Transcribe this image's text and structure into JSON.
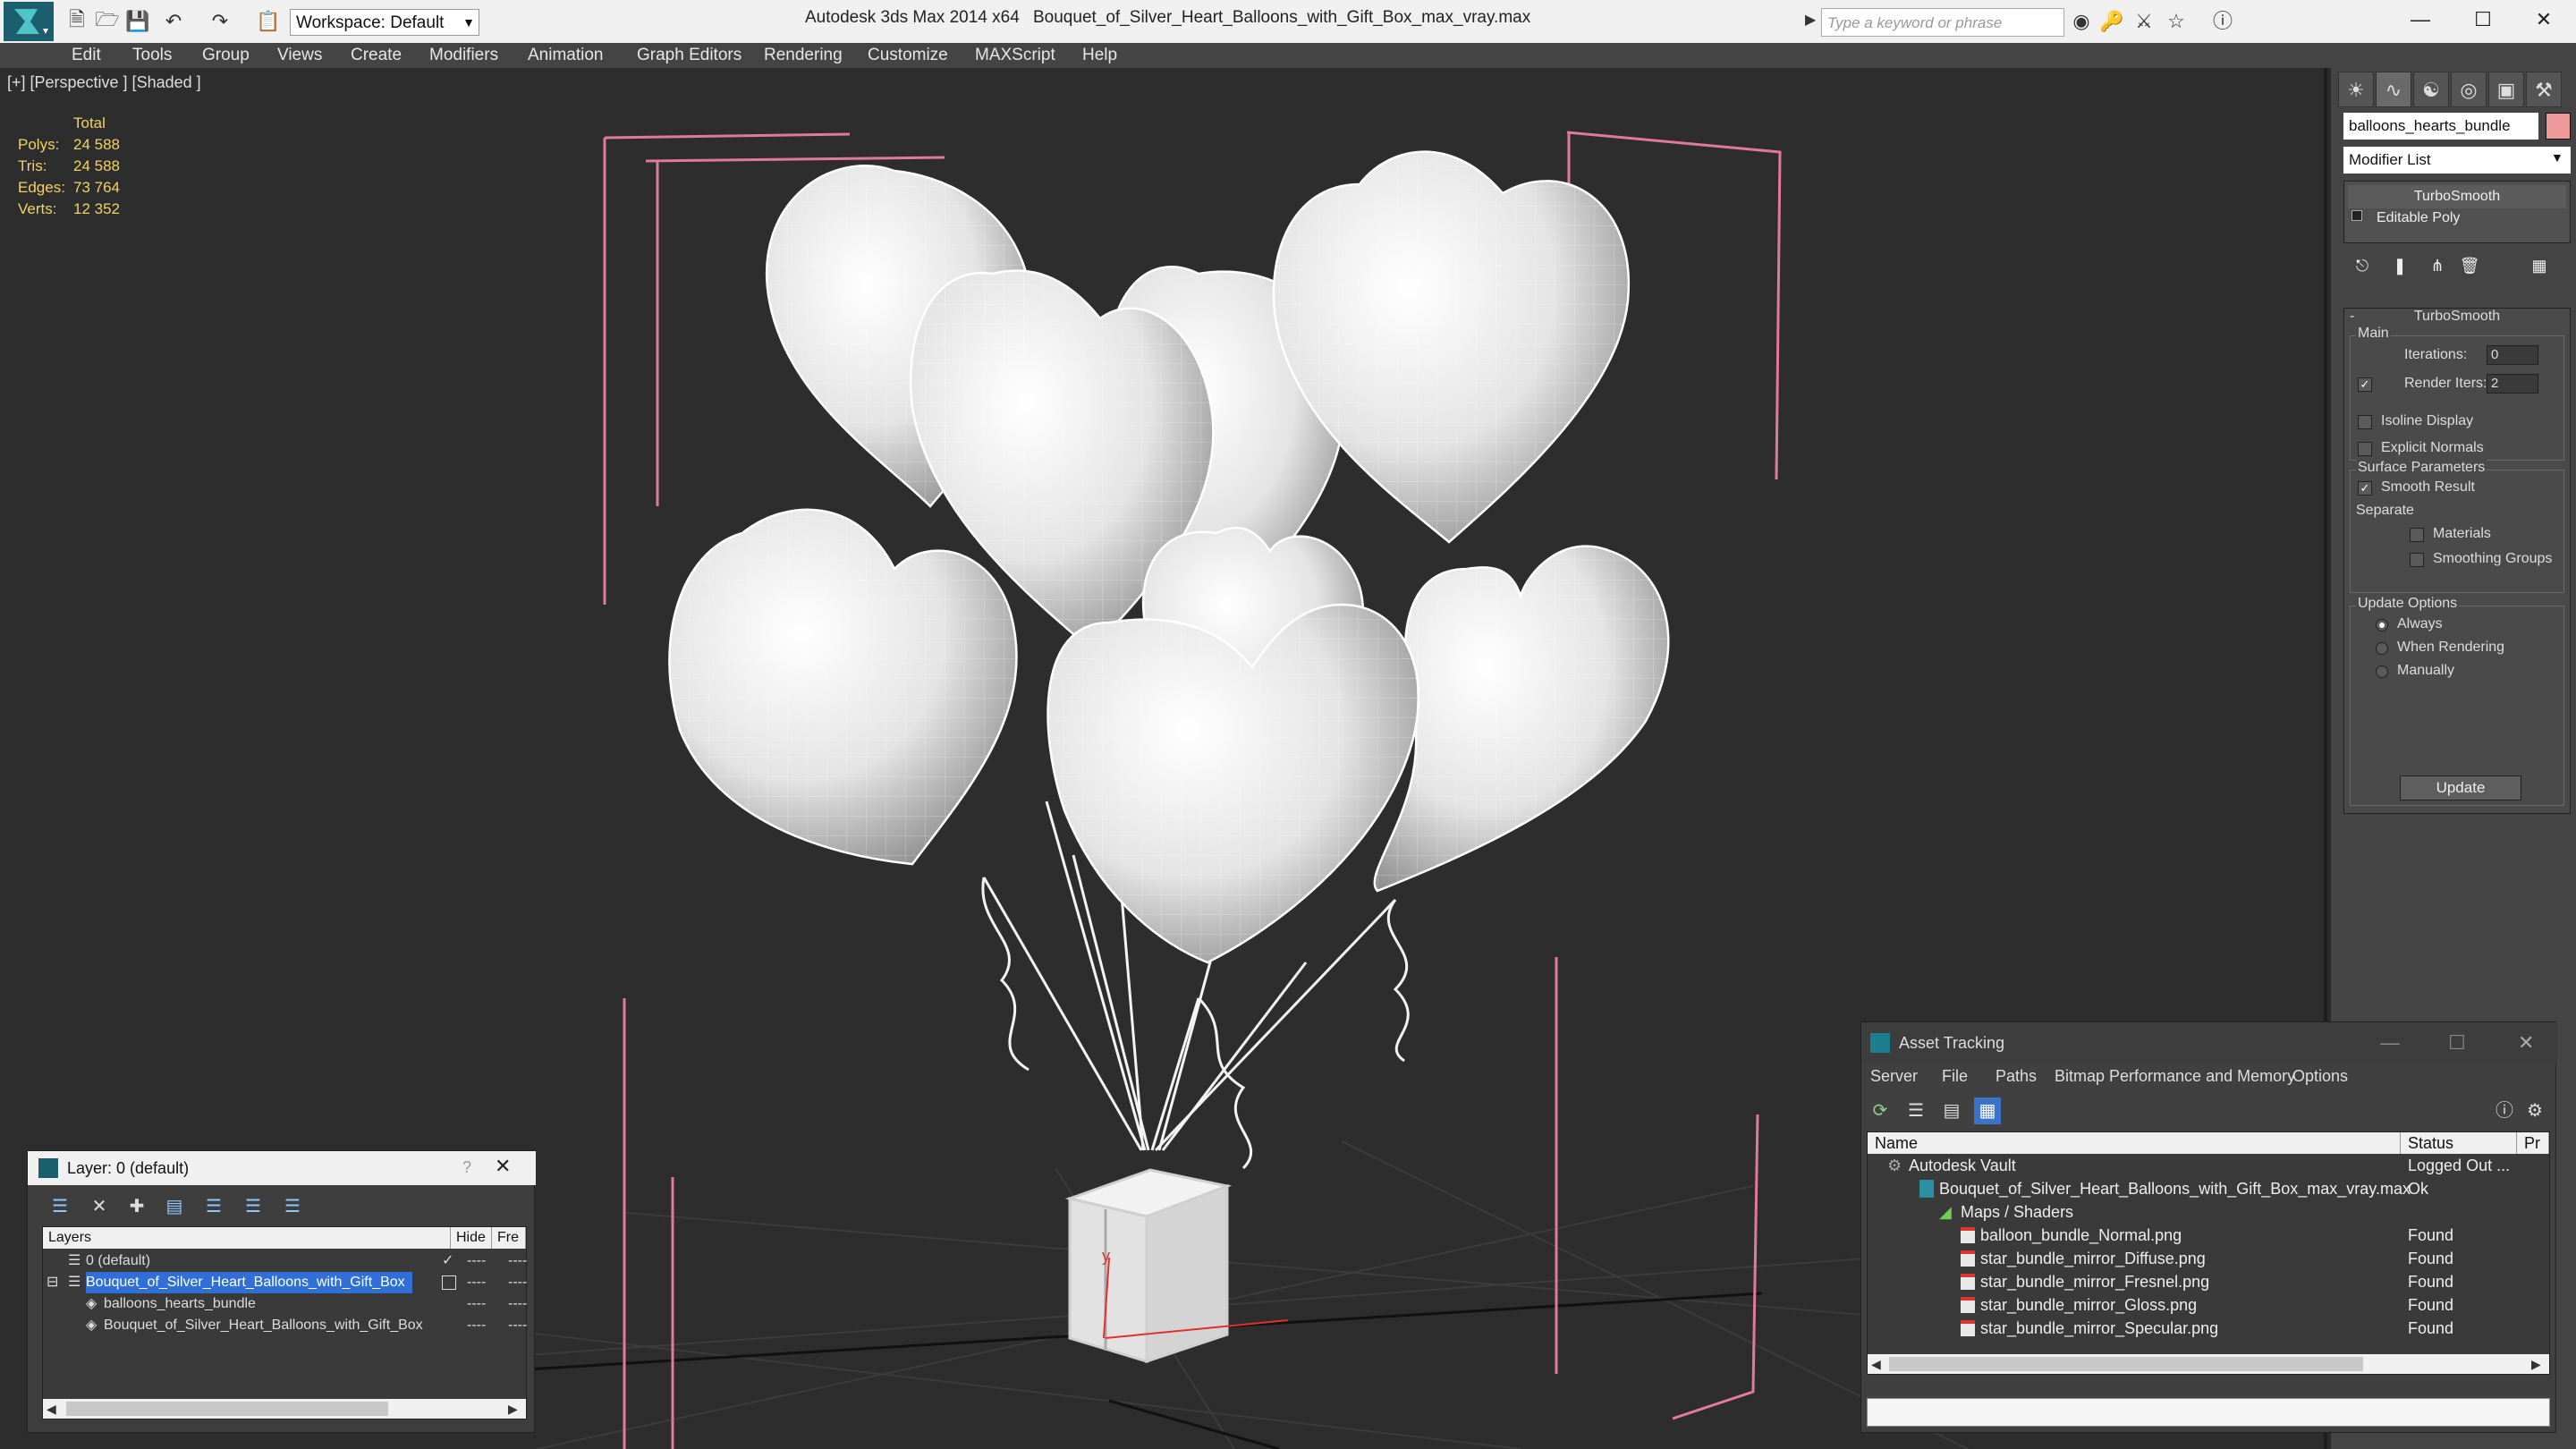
{
  "titlebar": {
    "workspace": "Workspace: Default",
    "app_title": "Autodesk 3ds Max  2014 x64",
    "file_title": "Bouquet_of_Silver_Heart_Balloons_with_Gift_Box_max_vray.max",
    "search_placeholder": "Type a keyword or phrase"
  },
  "menubar": [
    "Edit",
    "Tools",
    "Group",
    "Views",
    "Create",
    "Modifiers",
    "Animation",
    "Graph Editors",
    "Rendering",
    "Customize",
    "MAXScript",
    "Help"
  ],
  "viewport": {
    "label": "[+] [Perspective ] [Shaded ]",
    "stats_header": "Total",
    "stats": [
      {
        "label": "Polys:",
        "value": "24 588"
      },
      {
        "label": "Tris:",
        "value": "24 588"
      },
      {
        "label": "Edges:",
        "value": "73 764"
      },
      {
        "label": "Verts:",
        "value": "12 352"
      }
    ],
    "axis_label": "y"
  },
  "command_panel": {
    "object_name": "balloons_hearts_bundle",
    "object_color": "#ef9a9a",
    "modifier_list": "Modifier List",
    "stack": [
      "TurboSmooth",
      "Editable Poly"
    ],
    "rollout_title": "TurboSmooth",
    "main_label": "Main",
    "iterations_label": "Iterations:",
    "iterations_value": "0",
    "render_iters_label": "Render Iters:",
    "render_iters_value": "2",
    "render_iters_checked": true,
    "isoline_label": "Isoline Display",
    "explicit_label": "Explicit Normals",
    "surface_label": "Surface Parameters",
    "smooth_result_label": "Smooth Result",
    "separate_label": "Separate",
    "materials_label": "Materials",
    "smoothing_groups_label": "Smoothing Groups",
    "update_options_label": "Update Options",
    "update_options": [
      "Always",
      "When Rendering",
      "Manually"
    ],
    "update_selected": "Always",
    "update_button": "Update"
  },
  "layer_dialog": {
    "title": "Layer: 0 (default)",
    "help": "?",
    "columns": [
      "Layers",
      "Hide",
      "Fre"
    ],
    "rows": [
      {
        "name": "0 (default)",
        "indent": 0,
        "selected": false,
        "active": true
      },
      {
        "name": "Bouquet_of_Silver_Heart_Balloons_with_Gift_Box",
        "indent": 0,
        "selected": true,
        "active": false
      },
      {
        "name": "balloons_hearts_bundle",
        "indent": 1,
        "selected": false,
        "active": false
      },
      {
        "name": "Bouquet_of_Silver_Heart_Balloons_with_Gift_Box",
        "indent": 1,
        "selected": false,
        "active": false
      }
    ],
    "row_dash": "----"
  },
  "asset_tracking": {
    "title": "Asset Tracking",
    "menu": [
      "Server",
      "File",
      "Paths",
      "Bitmap Performance and Memory",
      "Options"
    ],
    "columns": [
      "Name",
      "Status",
      "Pr"
    ],
    "rows": [
      {
        "name": "Autodesk Vault",
        "status": "Logged Out ...",
        "indent": 0
      },
      {
        "name": "Bouquet_of_Silver_Heart_Balloons_with_Gift_Box_max_vray.max",
        "status": "Ok",
        "indent": 1
      },
      {
        "name": "Maps / Shaders",
        "status": "",
        "indent": 2
      },
      {
        "name": "balloon_bundle_Normal.png",
        "status": "Found",
        "indent": 3
      },
      {
        "name": "star_bundle_mirror_Diffuse.png",
        "status": "Found",
        "indent": 3
      },
      {
        "name": "star_bundle_mirror_Fresnel.png",
        "status": "Found",
        "indent": 3
      },
      {
        "name": "star_bundle_mirror_Gloss.png",
        "status": "Found",
        "indent": 3
      },
      {
        "name": "star_bundle_mirror_Specular.png",
        "status": "Found",
        "indent": 3
      }
    ]
  }
}
